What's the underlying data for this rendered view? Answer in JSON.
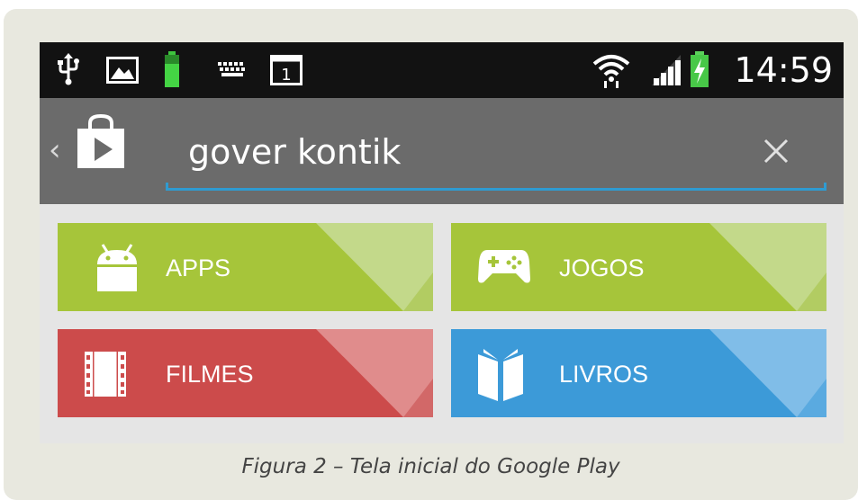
{
  "status_bar": {
    "time": "14:59",
    "left_icons": [
      "usb-icon",
      "image-icon",
      "battery-charging-icon",
      "keyboard-icon",
      "calendar-icon"
    ],
    "right_icons": [
      "wifi-icon",
      "signal-icon",
      "battery-icon"
    ],
    "calendar_day": "1"
  },
  "action_bar": {
    "search_value": "gover kontik",
    "icons": [
      "back-chevron-icon",
      "play-store-icon",
      "clear-icon"
    ]
  },
  "tiles": [
    {
      "label": "APPS",
      "icon": "android-icon",
      "color": "#a6c53a"
    },
    {
      "label": "JOGOS",
      "icon": "gamepad-icon",
      "color": "#a6c53a"
    },
    {
      "label": "FILMES",
      "icon": "film-icon",
      "color": "#cc4b4b"
    },
    {
      "label": "LIVROS",
      "icon": "book-icon",
      "color": "#3c9ad8"
    }
  ],
  "caption": "Figura 2 – Tela inicial do Google Play",
  "colors": {
    "status_bar": "#121212",
    "action_bar": "#6b6b6b",
    "search_underline": "#2f9bd1",
    "green": "#a6c53a",
    "red": "#cc4b4b",
    "blue": "#3c9ad8"
  }
}
